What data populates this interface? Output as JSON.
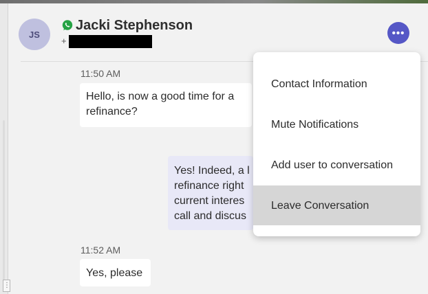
{
  "header": {
    "avatar_initials": "JS",
    "contact_name": "Jacki Stephenson",
    "phone_prefix": "+",
    "more_button_label": "•••",
    "channel_icon": "whatsapp-icon"
  },
  "messages": [
    {
      "time": "11:50 AM",
      "direction": "incoming",
      "lines": [
        "Hello, is now a good time for a",
        "refinance?"
      ]
    },
    {
      "direction": "outgoing",
      "lines": [
        "Yes! Indeed, a l",
        "refinance right",
        "current interes",
        "call and discus"
      ]
    },
    {
      "time": "11:52 AM",
      "direction": "incoming",
      "lines": [
        "Yes, please"
      ]
    }
  ],
  "menu": {
    "items": [
      {
        "label": "Contact Information"
      },
      {
        "label": "Mute Notifications"
      },
      {
        "label": "Add user to conversation"
      },
      {
        "label": "Leave Conversation"
      }
    ],
    "highlighted_index": 3
  },
  "rail": {
    "grip_label": "⋮"
  },
  "colors": {
    "accent": "#5557c6",
    "avatar_bg": "#bfc0df",
    "whatsapp_green": "#25a244",
    "outgoing_bubble": "#e8e8f7",
    "menu_highlight": "#d6d6d6"
  }
}
